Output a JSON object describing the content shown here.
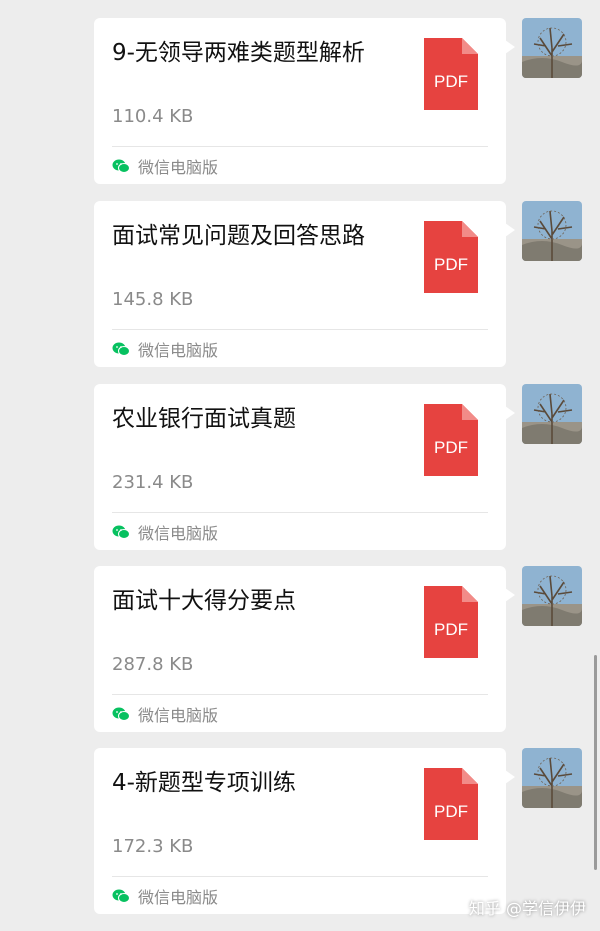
{
  "messages": [
    {
      "title": "9-无领导两难类题型解析",
      "size": "110.4 KB",
      "source": "微信电脑版",
      "file_badge": "PDF"
    },
    {
      "title": "面试常见问题及回答思路",
      "size": "145.8 KB",
      "source": "微信电脑版",
      "file_badge": "PDF"
    },
    {
      "title": "农业银行面试真题",
      "size": "231.4 KB",
      "source": "微信电脑版",
      "file_badge": "PDF"
    },
    {
      "title": "面试十大得分要点",
      "size": "287.8 KB",
      "source": "微信电脑版",
      "file_badge": "PDF"
    },
    {
      "title": "4-新题型专项训练",
      "size": "172.3 KB",
      "source": "微信电脑版",
      "file_badge": "PDF"
    }
  ],
  "watermark": "知乎 @学信伊伊",
  "colors": {
    "background": "#ededed",
    "bubble": "#ffffff",
    "pdf_red": "#e64340",
    "wechat_green": "#07c160"
  },
  "icons": {
    "file": "pdf-file-icon",
    "source": "wechat-icon",
    "avatar": "tree-avatar"
  }
}
